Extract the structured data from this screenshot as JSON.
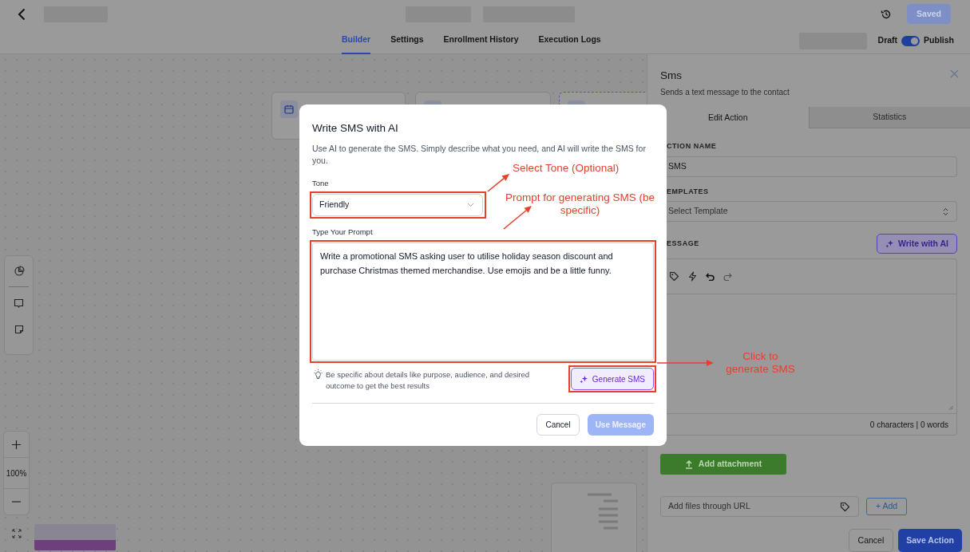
{
  "header": {
    "save_button": {
      "label": "Saved",
      "disabled": true
    }
  },
  "tabs": [
    {
      "label": "Builder",
      "selected": true
    },
    {
      "label": "Settings",
      "selected": false
    },
    {
      "label": "Enrollment History",
      "selected": false
    },
    {
      "label": "Execution Logs",
      "selected": false
    }
  ],
  "publish_toggle": {
    "off_label": "Draft",
    "on_label": "Publish",
    "on": true
  },
  "canvas": {
    "zoom": "100%"
  },
  "side_panel": {
    "title": "Sms",
    "subtitle": "Sends a text message to the contact",
    "tabs": [
      {
        "label": "Edit Action",
        "selected": true
      },
      {
        "label": "Statistics",
        "selected": false
      }
    ],
    "action_name": {
      "label": "CTION NAME",
      "value": "SMS"
    },
    "templates": {
      "label": "EMPLATES",
      "placeholder": "Select Template"
    },
    "message": {
      "label": "ESSAGE",
      "ai_button": "Write with AI",
      "counter": "0 characters | 0 words"
    },
    "attachment_button": "Add attachment",
    "url_field": {
      "placeholder": "Add files through URL"
    },
    "add_button": "+ Add",
    "buttons": [
      "Cancel",
      "Save Action"
    ]
  },
  "modal": {
    "title": "Write SMS with AI",
    "description": "Use AI to generate the SMS. Simply describe what you need, and AI will write the SMS for you.",
    "tone": {
      "label": "Tone",
      "value": "Friendly"
    },
    "prompt": {
      "label": "Type Your Prompt",
      "value": "Write a promotional SMS asking user to utilise holiday season discount and purchase Christmas themed merchandise. Use emojis and be a little funny."
    },
    "hint": "Be specific about details like purpose, audience, and desired outcome to get the best results",
    "generate_button": "Generate SMS",
    "buttons": [
      {
        "label": "Cancel",
        "disabled": false
      },
      {
        "label": "Use Message",
        "disabled": true
      }
    ]
  },
  "annotations": [
    {
      "text": "Select Tone (Optional)"
    },
    {
      "text": "Prompt for generating SMS (be specific)"
    },
    {
      "text": "Click to generate SMS"
    }
  ]
}
